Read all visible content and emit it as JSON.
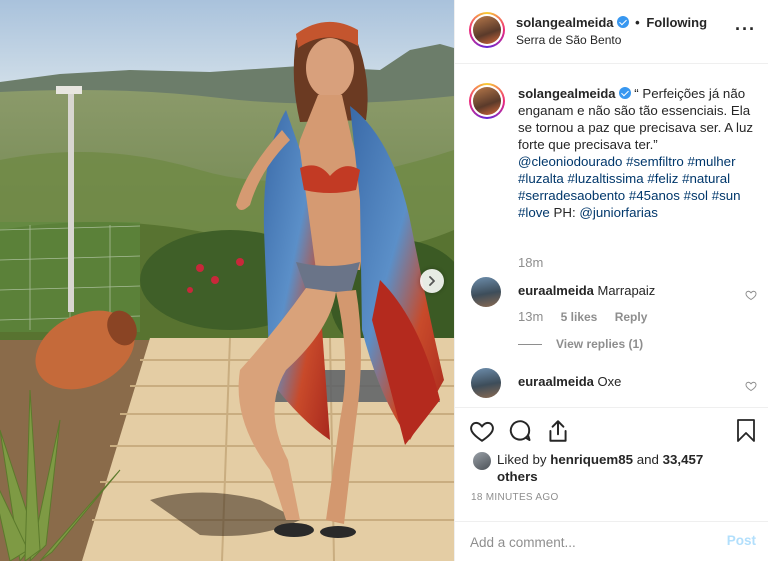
{
  "post": {
    "username": "solangealmeida",
    "follow_status": "Following",
    "separator": "•",
    "location": "Serra de São Bento",
    "more_glyph": "···"
  },
  "caption": {
    "username": "solangealmeida",
    "text": "“ Perfeições já não enganam e não são tão essenciais. Ela se tornou a paz que precisava ser. A luz forte que precisava ter.”",
    "mention": "@cleoniodourado",
    "hashtags": "#semfiltro #mulher #luzalta #luzaltissima #feliz #natural #serradesaobento #45anos #sol #sun #love",
    "credit_prefix": "PH:",
    "credit_mention": "@juniorfarias",
    "time": "18m"
  },
  "comments": [
    {
      "username": "euraalmeida",
      "text": "Marrapaiz",
      "time": "13m",
      "likes": "5 likes",
      "reply_label": "Reply",
      "view_replies": "View replies (1)"
    },
    {
      "username": "euraalmeida",
      "text": "Oxe"
    }
  ],
  "likes": {
    "prefix": "Liked by",
    "user": "henriquem85",
    "conjunction": "and",
    "others": "33,457 others"
  },
  "timestamp": "18 MINUTES AGO",
  "add_comment": {
    "placeholder": "Add a comment...",
    "post_label": "Post"
  },
  "colors": {
    "link": "#00376b",
    "verified": "#3897f0",
    "post_disabled": "#b2dffc",
    "muted": "#8e8e8e"
  }
}
